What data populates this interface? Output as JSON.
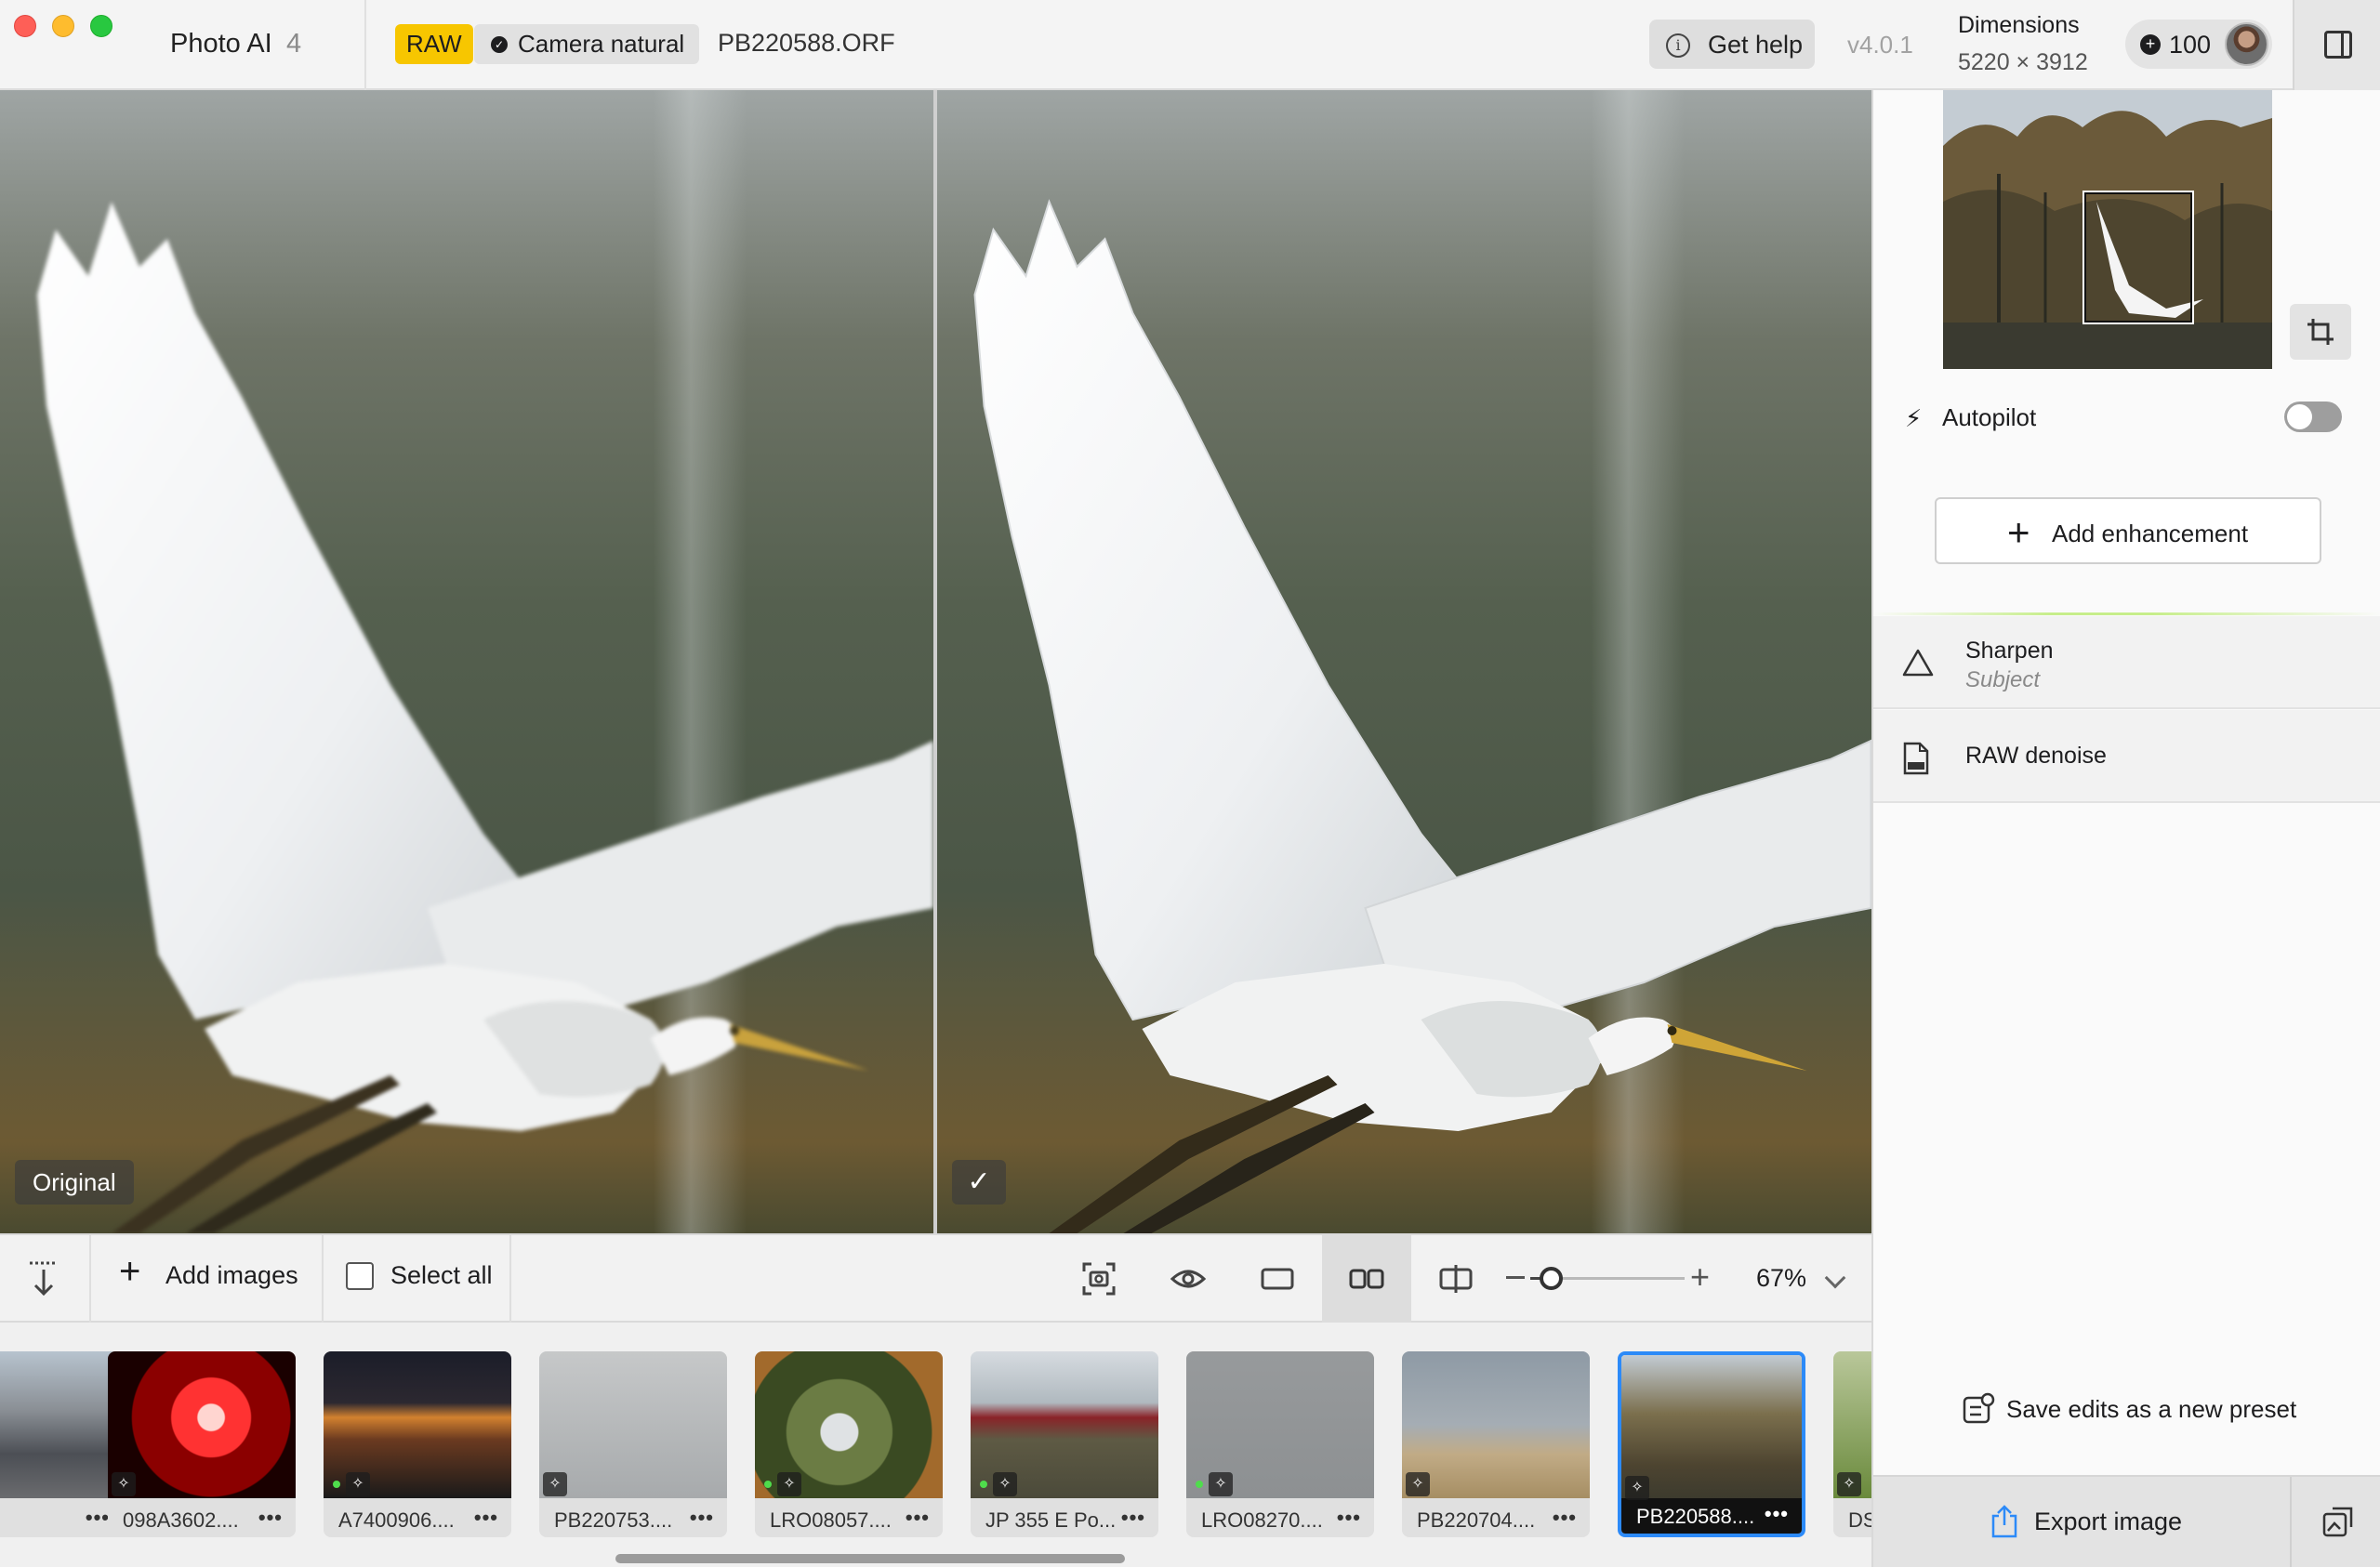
{
  "titlebar": {
    "app_name": "Photo AI",
    "app_version": "4",
    "raw_badge": "RAW",
    "preset_badge": "Camera natural",
    "filename": "PB220588.ORF",
    "help_label": "Get help",
    "build_version": "v4.0.1",
    "dimensions_label": "Dimensions",
    "dimensions_value": "5220 × 3912",
    "credits": "100"
  },
  "viewer": {
    "left_label": "Original",
    "right_label": "✓"
  },
  "toolbar": {
    "add_images": "Add images",
    "select_all": "Select all",
    "zoom": "67%",
    "zoom_level": 0.07,
    "buttons": [
      "screenshot-icon",
      "eye-icon",
      "single-view-icon",
      "side-by-side-icon",
      "split-view-icon"
    ]
  },
  "filmstrip": {
    "items": [
      {
        "name": "...",
        "scene": "street"
      },
      {
        "name": "098A3602....",
        "scene": "dancer"
      },
      {
        "name": "A7400906....",
        "scene": "night-market"
      },
      {
        "name": "PB220753....",
        "scene": "gull-water"
      },
      {
        "name": "LRO08057....",
        "scene": "bird-branch"
      },
      {
        "name": "JP 355 E Po...",
        "scene": "train"
      },
      {
        "name": "LRO08270....",
        "scene": "flock"
      },
      {
        "name": "PB220704....",
        "scene": "gull-beach"
      },
      {
        "name": "PB220588....",
        "scene": "egret",
        "selected": true
      },
      {
        "name": "DS",
        "scene": "partial"
      }
    ]
  },
  "panel": {
    "autopilot_label": "Autopilot",
    "autopilot_on": false,
    "add_enhancement": "Add enhancement",
    "enhancements": [
      {
        "title": "Sharpen",
        "subtitle": "Subject",
        "icon": "triangle-icon"
      },
      {
        "title": "RAW denoise",
        "subtitle": "",
        "icon": "raw-file-icon"
      }
    ],
    "save_preset": "Save edits as a new preset",
    "export": "Export image"
  }
}
